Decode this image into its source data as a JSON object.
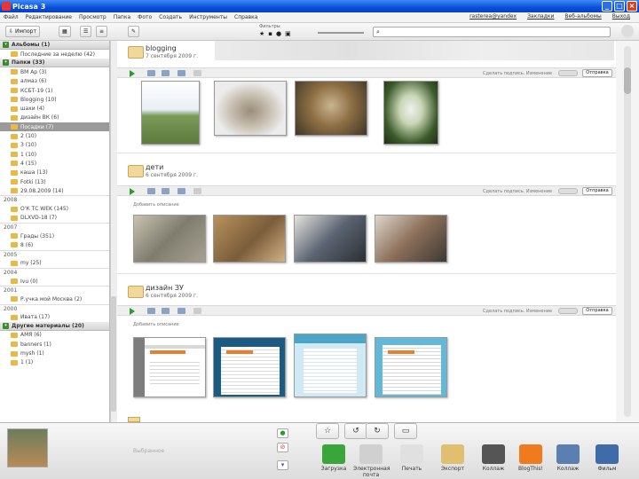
{
  "window": {
    "title": "Picasa 3"
  },
  "menu": {
    "items": [
      "Файл",
      "Редактирование",
      "Просмотр",
      "Папка",
      "Фото",
      "Создать",
      "Инструменты",
      "Справка"
    ],
    "right": [
      "rasterea@yandex",
      "Закладки",
      "Веб-альбомы",
      "Выход"
    ]
  },
  "toolbar": {
    "import_label": "Импорт",
    "filter_label": "Фильтры"
  },
  "sidebar": {
    "sections": [
      {
        "title": "Альбомы (1)",
        "items": [
          "Последние за неделю (42)"
        ]
      },
      {
        "title": "Папки (33)",
        "items": [
          "ВМ Ар (3)",
          "алмаз (6)",
          "КСБТ-19 (1)",
          "Blogging (10)",
          "шахи (4)",
          "дизайн ВК (6)",
          "Посадки (7)",
          "2 (10)",
          "3 (10)",
          "1 (10)",
          "4 (15)",
          "каша (13)",
          "Fotki (13)",
          "29.08.2009 (14)"
        ]
      },
      {
        "year": "2008",
        "items": [
          "О'К ТС WEK (145)",
          "DLXVD-18 (7)"
        ]
      },
      {
        "year": "2007",
        "items": [
          "Грады (351)",
          "8 (6)"
        ]
      },
      {
        "year": "2005",
        "items": [
          "my (25)"
        ]
      },
      {
        "year": "2004",
        "items": [
          "Ivu (0)"
        ]
      },
      {
        "year": "2001",
        "items": [
          "Р.учка мой Москва (2)"
        ]
      },
      {
        "year": "2000",
        "items": [
          "Ивата (17)"
        ]
      },
      {
        "title": "Другие материалы (20)",
        "items": [
          "АМЯ (6)",
          "banners (1)",
          "mysh (1)",
          "1 (1)"
        ]
      }
    ],
    "selected": "Посадки (7)"
  },
  "albums": [
    {
      "name": "blogging",
      "date": "7 сентября 2009 г."
    },
    {
      "name": "дети",
      "date": "6 сентября 2009 г.",
      "caption": "Добавить описание"
    },
    {
      "name": "дизайн ЗУ",
      "date": "6 сентября 2009 г.",
      "caption": "Добавить описание"
    }
  ],
  "album_toolbar": {
    "desc": "Сделать подпись. Изменение",
    "send_label": "Отправка"
  },
  "bottom": {
    "tray_label": "Выбранное",
    "actions": [
      "Загрузка",
      "Электронная почта",
      "Печать",
      "Экспорт",
      "Коллаж",
      "BlogThis!",
      "Коллаж",
      "Фильм"
    ]
  }
}
